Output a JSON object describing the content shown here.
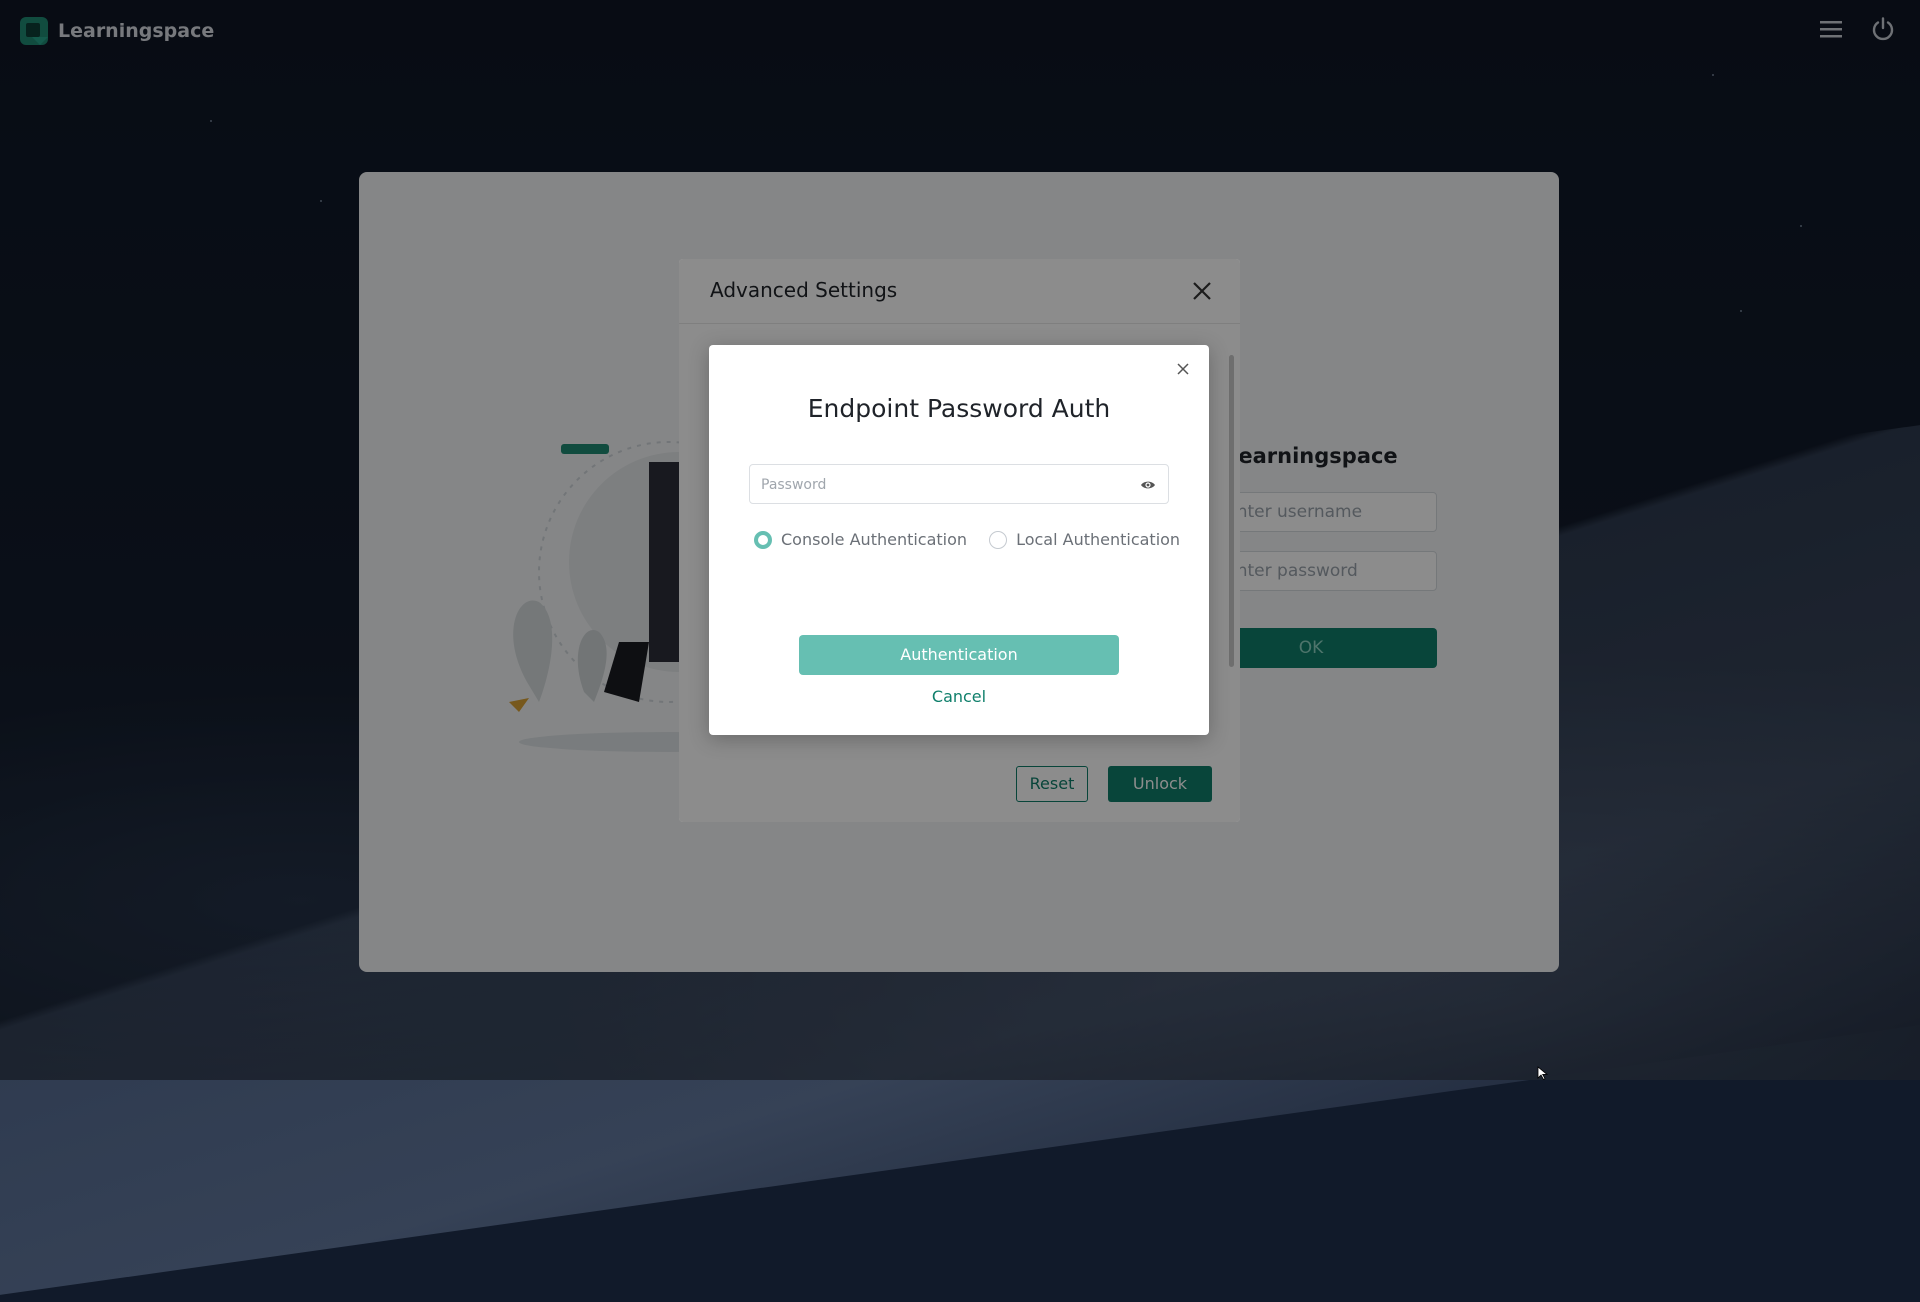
{
  "app": {
    "brand_name": "Learningspace"
  },
  "topbar": {
    "icons": [
      "menu-icon",
      "power-icon"
    ]
  },
  "login_card": {
    "title": "Learningspace",
    "username_placeholder": "Enter username",
    "password_placeholder": "Enter password",
    "ok_label": "OK"
  },
  "advanced_settings": {
    "title": "Advanced Settings",
    "reset_label": "Reset",
    "unlock_label": "Unlock"
  },
  "auth_modal": {
    "title": "Endpoint Password Auth",
    "password_placeholder": "Password",
    "password_value": "",
    "radio_options": [
      {
        "label": "Console Authentication",
        "checked": true
      },
      {
        "label": "Local Authentication",
        "checked": false
      }
    ],
    "authenticate_label": "Authentication",
    "cancel_label": "Cancel"
  },
  "colors": {
    "accent": "#0f7f6b",
    "accent_light": "#66bfb2"
  }
}
